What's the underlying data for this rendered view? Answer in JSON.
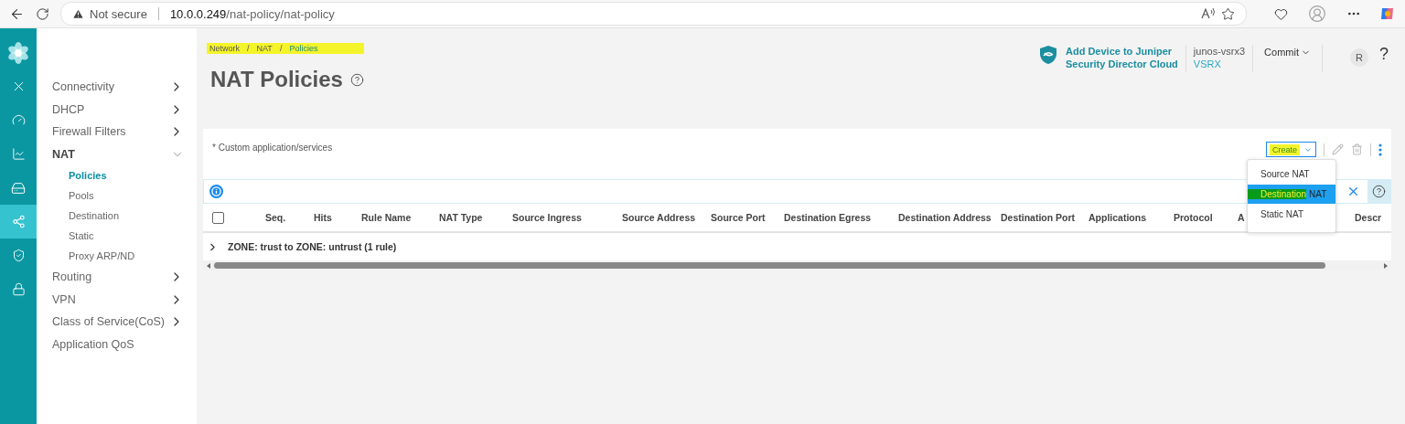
{
  "browser": {
    "security": "Not secure",
    "url_host": "10.0.0.249",
    "url_path": "/nat-policy/nat-policy"
  },
  "rail": [
    {
      "kind": "logo",
      "selected": false
    },
    {
      "kind": "close",
      "selected": false
    },
    {
      "kind": "gauge",
      "selected": false
    },
    {
      "kind": "chart",
      "selected": false
    },
    {
      "kind": "device",
      "selected": false
    },
    {
      "kind": "network",
      "selected": true
    },
    {
      "kind": "shield",
      "selected": false
    },
    {
      "kind": "lock",
      "selected": false
    }
  ],
  "sidebar": {
    "items": [
      {
        "label": "Connectivity",
        "expanded": false
      },
      {
        "label": "DHCP",
        "expanded": false
      },
      {
        "label": "Firewall Filters",
        "expanded": false
      },
      {
        "label": "NAT",
        "expanded": true,
        "children": [
          {
            "label": "Policies",
            "selected": true
          },
          {
            "label": "Pools",
            "selected": false
          },
          {
            "label": "Destination",
            "selected": false
          },
          {
            "label": "Static",
            "selected": false
          },
          {
            "label": "Proxy ARP/ND",
            "selected": false
          }
        ]
      },
      {
        "label": "Routing",
        "expanded": false
      },
      {
        "label": "VPN",
        "expanded": false
      },
      {
        "label": "Class of Service(CoS)",
        "expanded": false
      },
      {
        "label": "Application QoS"
      }
    ]
  },
  "breadcrumb": {
    "highlighted": true,
    "separators": [
      "/",
      "/"
    ],
    "items": [
      {
        "label": "Network",
        "selected": false
      },
      {
        "label": "NAT",
        "selected": false
      },
      {
        "label": "Policies",
        "selected": true
      }
    ]
  },
  "page_title": "NAT Policies",
  "header": {
    "cloud_link": [
      "Add Device to Juniper",
      "Security Director Cloud"
    ],
    "device_name": "junos-vsrx3",
    "device_type": "VSRX",
    "commit": "Commit",
    "avatar": "R",
    "help": "?"
  },
  "card": {
    "note": "* Custom application/services",
    "create_button": {
      "label": "Create",
      "highlighted": true
    },
    "create_menu": [
      {
        "parts": [
          {
            "text": "Source NAT",
            "highlight": false
          }
        ],
        "selected": false
      },
      {
        "parts": [
          {
            "text": "Destination",
            "highlight": true
          },
          {
            "text": "NAT",
            "highlight": false
          }
        ],
        "selected": true
      },
      {
        "parts": [
          {
            "text": "Static NAT",
            "highlight": false
          }
        ],
        "selected": false
      }
    ],
    "table": {
      "columns": [
        "Seq.",
        "Hits",
        "Rule Name",
        "NAT Type",
        "Source Ingress",
        "Source Address",
        "Source Port",
        "Destination Egress",
        "Destination Address",
        "Destination Port",
        "Applications",
        "Protocol",
        "A",
        "Descr"
      ],
      "select_all_checked": false,
      "groups": [
        {
          "label": "ZONE: trust to ZONE: untrust (1 rule)",
          "expanded": false
        }
      ]
    }
  }
}
